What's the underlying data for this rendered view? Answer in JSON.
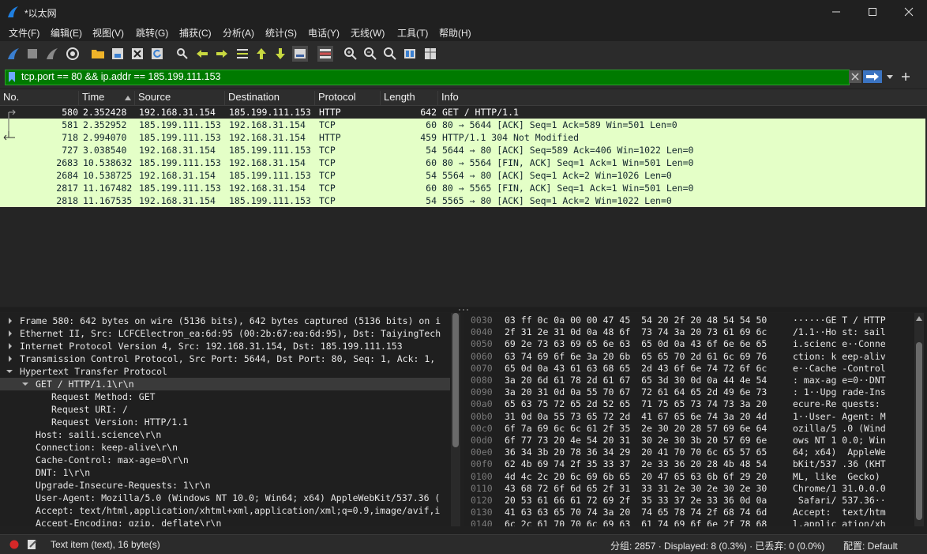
{
  "window": {
    "title": "*以太网",
    "minimize_icon": "minimize-icon",
    "maximize_icon": "maximize-icon",
    "close_icon": "close-icon"
  },
  "menu": [
    "文件(F)",
    "编辑(E)",
    "视图(V)",
    "跳转(G)",
    "捕获(C)",
    "分析(A)",
    "统计(S)",
    "电话(Y)",
    "无线(W)",
    "工具(T)",
    "帮助(H)"
  ],
  "toolbar": [
    "shark-fin-start-icon",
    "stop-square-icon",
    "restart-fin-icon",
    "options-gear-icon",
    "open-folder-icon",
    "save-file-icon",
    "close-file-icon",
    "reload-icon",
    "find-packet-icon",
    "go-back-icon",
    "go-forward-icon",
    "go-to-packet-icon",
    "go-first-icon",
    "go-last-icon",
    "autoscroll-icon",
    "colorize-icon",
    "zoom-in-icon",
    "zoom-out-icon",
    "zoom-normal-icon",
    "resize-columns-icon",
    "layout-icon"
  ],
  "filter": {
    "value": "tcp.port == 80 && ip.addr == 185.199.111.153",
    "accent": "#007a00"
  },
  "columns": [
    "No.",
    "Time",
    "Source",
    "Destination",
    "Protocol",
    "Length",
    "Info"
  ],
  "packets": [
    {
      "no": "580",
      "time": "2.352428",
      "src": "192.168.31.154",
      "dst": "185.199.111.153",
      "proto": "HTTP",
      "len": "642",
      "info": "GET / HTTP/1.1"
    },
    {
      "no": "581",
      "time": "2.352952",
      "src": "185.199.111.153",
      "dst": "192.168.31.154",
      "proto": "TCP",
      "len": "60",
      "info": "80 → 5644 [ACK] Seq=1 Ack=589 Win=501 Len=0"
    },
    {
      "no": "718",
      "time": "2.994070",
      "src": "185.199.111.153",
      "dst": "192.168.31.154",
      "proto": "HTTP",
      "len": "459",
      "info": "HTTP/1.1 304 Not Modified"
    },
    {
      "no": "727",
      "time": "3.038540",
      "src": "192.168.31.154",
      "dst": "185.199.111.153",
      "proto": "TCP",
      "len": "54",
      "info": "5644 → 80 [ACK] Seq=589 Ack=406 Win=1022 Len=0"
    },
    {
      "no": "2683",
      "time": "10.538632",
      "src": "185.199.111.153",
      "dst": "192.168.31.154",
      "proto": "TCP",
      "len": "60",
      "info": "80 → 5564 [FIN, ACK] Seq=1 Ack=1 Win=501 Len=0"
    },
    {
      "no": "2684",
      "time": "10.538725",
      "src": "192.168.31.154",
      "dst": "185.199.111.153",
      "proto": "TCP",
      "len": "54",
      "info": "5564 → 80 [ACK] Seq=1 Ack=2 Win=1026 Len=0"
    },
    {
      "no": "2817",
      "time": "11.167482",
      "src": "185.199.111.153",
      "dst": "192.168.31.154",
      "proto": "TCP",
      "len": "60",
      "info": "80 → 5565 [FIN, ACK] Seq=1 Ack=1 Win=501 Len=0"
    },
    {
      "no": "2818",
      "time": "11.167535",
      "src": "192.168.31.154",
      "dst": "185.199.111.153",
      "proto": "TCP",
      "len": "54",
      "info": "5565 → 80 [ACK] Seq=1 Ack=2 Win=1022 Len=0"
    }
  ],
  "row_color": "#e4ffc7",
  "details": [
    "Frame 580: 642 bytes on wire (5136 bits), 642 bytes captured (5136 bits) on i",
    "Ethernet II, Src: LCFCElectron_ea:6d:95 (00:2b:67:ea:6d:95), Dst: TaiyingTech",
    "Internet Protocol Version 4, Src: 192.168.31.154, Dst: 185.199.111.153",
    "Transmission Control Protocol, Src Port: 5644, Dst Port: 80, Seq: 1, Ack: 1,",
    "Hypertext Transfer Protocol",
    "GET / HTTP/1.1\\r\\n",
    "Request Method: GET",
    "Request URI: /",
    "Request Version: HTTP/1.1",
    "Host: saili.science\\r\\n",
    "Connection: keep-alive\\r\\n",
    "Cache-Control: max-age=0\\r\\n",
    "DNT: 1\\r\\n",
    "Upgrade-Insecure-Requests: 1\\r\\n",
    "User-Agent: Mozilla/5.0 (Windows NT 10.0; Win64; x64) AppleWebKit/537.36 (",
    "Accept: text/html,application/xhtml+xml,application/xml;q=0.9,image/avif,i",
    "Accept-Encoding: gzip, deflate\\r\\n"
  ],
  "hex": [
    {
      "off": "0030",
      "bytes": "03 ff 0c 0a 00 00 47 45  54 20 2f 20 48 54 54 50",
      "ascii": "······GE T / HTTP"
    },
    {
      "off": "0040",
      "bytes": "2f 31 2e 31 0d 0a 48 6f  73 74 3a 20 73 61 69 6c",
      "ascii": "/1.1··Ho st: sail"
    },
    {
      "off": "0050",
      "bytes": "69 2e 73 63 69 65 6e 63  65 0d 0a 43 6f 6e 6e 65",
      "ascii": "i.scienc e··Conne"
    },
    {
      "off": "0060",
      "bytes": "63 74 69 6f 6e 3a 20 6b  65 65 70 2d 61 6c 69 76",
      "ascii": "ction: k eep-aliv"
    },
    {
      "off": "0070",
      "bytes": "65 0d 0a 43 61 63 68 65  2d 43 6f 6e 74 72 6f 6c",
      "ascii": "e··Cache -Control"
    },
    {
      "off": "0080",
      "bytes": "3a 20 6d 61 78 2d 61 67  65 3d 30 0d 0a 44 4e 54",
      "ascii": ": max-ag e=0··DNT"
    },
    {
      "off": "0090",
      "bytes": "3a 20 31 0d 0a 55 70 67  72 61 64 65 2d 49 6e 73",
      "ascii": ": 1··Upg rade-Ins"
    },
    {
      "off": "00a0",
      "bytes": "65 63 75 72 65 2d 52 65  71 75 65 73 74 73 3a 20",
      "ascii": "ecure-Re quests: "
    },
    {
      "off": "00b0",
      "bytes": "31 0d 0a 55 73 65 72 2d  41 67 65 6e 74 3a 20 4d",
      "ascii": "1··User- Agent: M"
    },
    {
      "off": "00c0",
      "bytes": "6f 7a 69 6c 6c 61 2f 35  2e 30 20 28 57 69 6e 64",
      "ascii": "ozilla/5 .0 (Wind"
    },
    {
      "off": "00d0",
      "bytes": "6f 77 73 20 4e 54 20 31  30 2e 30 3b 20 57 69 6e",
      "ascii": "ows NT 1 0.0; Win"
    },
    {
      "off": "00e0",
      "bytes": "36 34 3b 20 78 36 34 29  20 41 70 70 6c 65 57 65",
      "ascii": "64; x64)  AppleWe"
    },
    {
      "off": "00f0",
      "bytes": "62 4b 69 74 2f 35 33 37  2e 33 36 20 28 4b 48 54",
      "ascii": "bKit/537 .36 (KHT"
    },
    {
      "off": "0100",
      "bytes": "4d 4c 2c 20 6c 69 6b 65  20 47 65 63 6b 6f 29 20",
      "ascii": "ML, like  Gecko) "
    },
    {
      "off": "0110",
      "bytes": "43 68 72 6f 6d 65 2f 31  33 31 2e 30 2e 30 2e 30",
      "ascii": "Chrome/1 31.0.0.0"
    },
    {
      "off": "0120",
      "bytes": "20 53 61 66 61 72 69 2f  35 33 37 2e 33 36 0d 0a",
      "ascii": " Safari/ 537.36··"
    },
    {
      "off": "0130",
      "bytes": "41 63 63 65 70 74 3a 20  74 65 78 74 2f 68 74 6d",
      "ascii": "Accept:  text/htm"
    },
    {
      "off": "0140",
      "bytes": "6c 2c 61 70 70 6c 69 63  61 74 69 6f 6e 2f 78 68",
      "ascii": "l,applic ation/xh"
    }
  ],
  "status": {
    "left_text": "Text item (text), 16 byte(s)",
    "right_text": "分组: 2857 · Displayed: 8 (0.3%) · 已丢弃: 0 (0.0%)",
    "profile": "配置: Default"
  }
}
